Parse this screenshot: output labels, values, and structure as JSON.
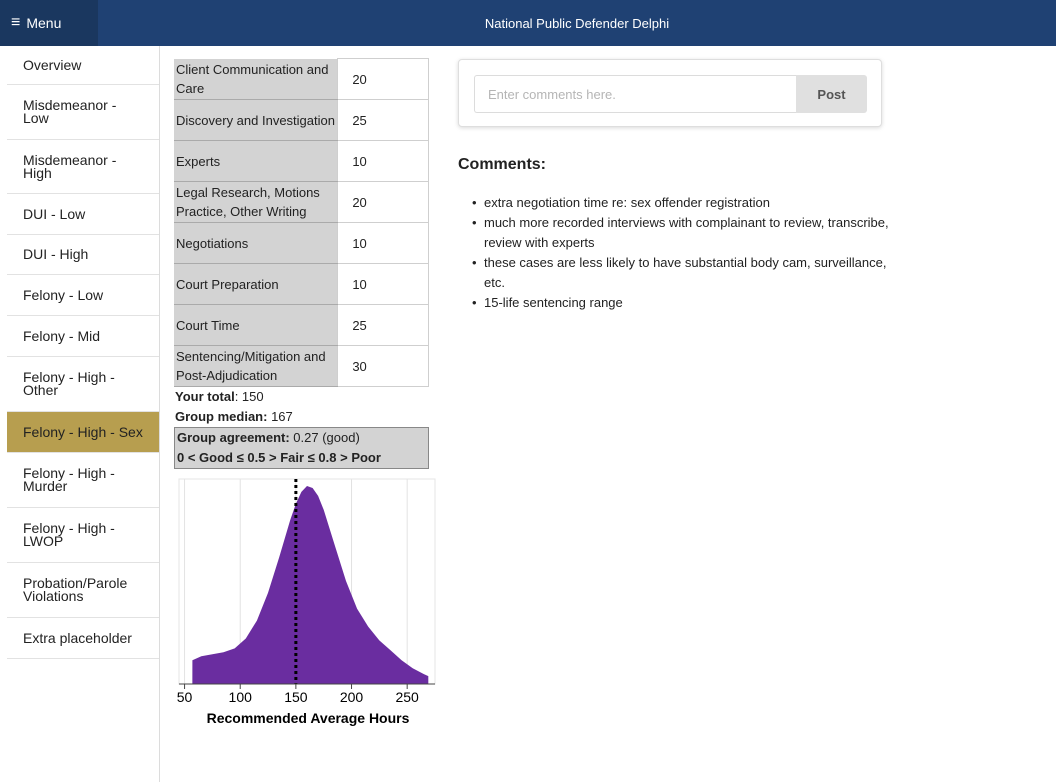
{
  "header": {
    "menu_icon": "≡",
    "menu_label": "Menu",
    "title": "National Public Defender Delphi"
  },
  "sidebar": {
    "items": [
      {
        "label": "Overview",
        "active": false
      },
      {
        "label": "Misdemeanor - Low",
        "active": false
      },
      {
        "label": "Misdemeanor - High",
        "active": false
      },
      {
        "label": "DUI - Low",
        "active": false
      },
      {
        "label": "DUI - High",
        "active": false
      },
      {
        "label": "Felony - Low",
        "active": false
      },
      {
        "label": "Felony - Mid",
        "active": false
      },
      {
        "label": "Felony - High - Other",
        "active": false
      },
      {
        "label": "Felony - High - Sex",
        "active": true
      },
      {
        "label": "Felony - High - Murder",
        "active": false
      },
      {
        "label": "Felony - High - LWOP",
        "active": false
      },
      {
        "label": "Probation/Parole Violations",
        "active": false
      },
      {
        "label": "Extra placeholder",
        "active": false
      }
    ],
    "active_color": "#b79e4f"
  },
  "allocations": [
    {
      "label": "Client Communication and Care",
      "value": "20"
    },
    {
      "label": "Discovery and Investigation",
      "value": "25"
    },
    {
      "label": "Experts",
      "value": "10"
    },
    {
      "label": "Legal Research, Motions Practice, Other Writing",
      "value": "20"
    },
    {
      "label": "Negotiations",
      "value": "10"
    },
    {
      "label": "Court Preparation",
      "value": "10"
    },
    {
      "label": "Court Time",
      "value": "25"
    },
    {
      "label": "Sentencing/Mitigation and Post-Adjudication",
      "value": "30"
    }
  ],
  "summary": {
    "total_label": "Your total",
    "total_value": ": 150",
    "median_label": "Group median:",
    "median_value": " 167",
    "agreement_label": "Group agreement:",
    "agreement_value": " 0.27 (good)",
    "scale_text": "0 < Good ≤ 0.5 > Fair ≤ 0.8 > Poor"
  },
  "chart_data": {
    "type": "area",
    "xlabel": "Recommended Average Hours",
    "x_ticks": [
      50,
      100,
      150,
      200,
      250
    ],
    "xlim": [
      45,
      275
    ],
    "fill_color": "#6a2da0",
    "marker_line_x": 150,
    "series": [
      {
        "x": [
          57,
          65,
          75,
          85,
          95,
          105,
          115,
          125,
          135,
          145,
          150,
          155,
          160,
          165,
          170,
          175,
          185,
          195,
          205,
          215,
          225,
          235,
          245,
          255,
          265,
          269
        ],
        "y": [
          0.12,
          0.14,
          0.15,
          0.16,
          0.18,
          0.23,
          0.32,
          0.46,
          0.64,
          0.83,
          0.91,
          0.97,
          1.0,
          0.99,
          0.95,
          0.88,
          0.7,
          0.52,
          0.38,
          0.29,
          0.22,
          0.17,
          0.12,
          0.08,
          0.05,
          0.04
        ]
      }
    ]
  },
  "comments": {
    "input_placeholder": "Enter comments here.",
    "post_label": "Post",
    "heading": "Comments:",
    "items": [
      "extra negotiation time re: sex offender registration",
      "much more recorded interviews with complainant to review, transcribe, review with experts",
      "these cases are less likely to have substantial body cam, surveillance, etc.",
      "15-life sentencing range"
    ]
  }
}
